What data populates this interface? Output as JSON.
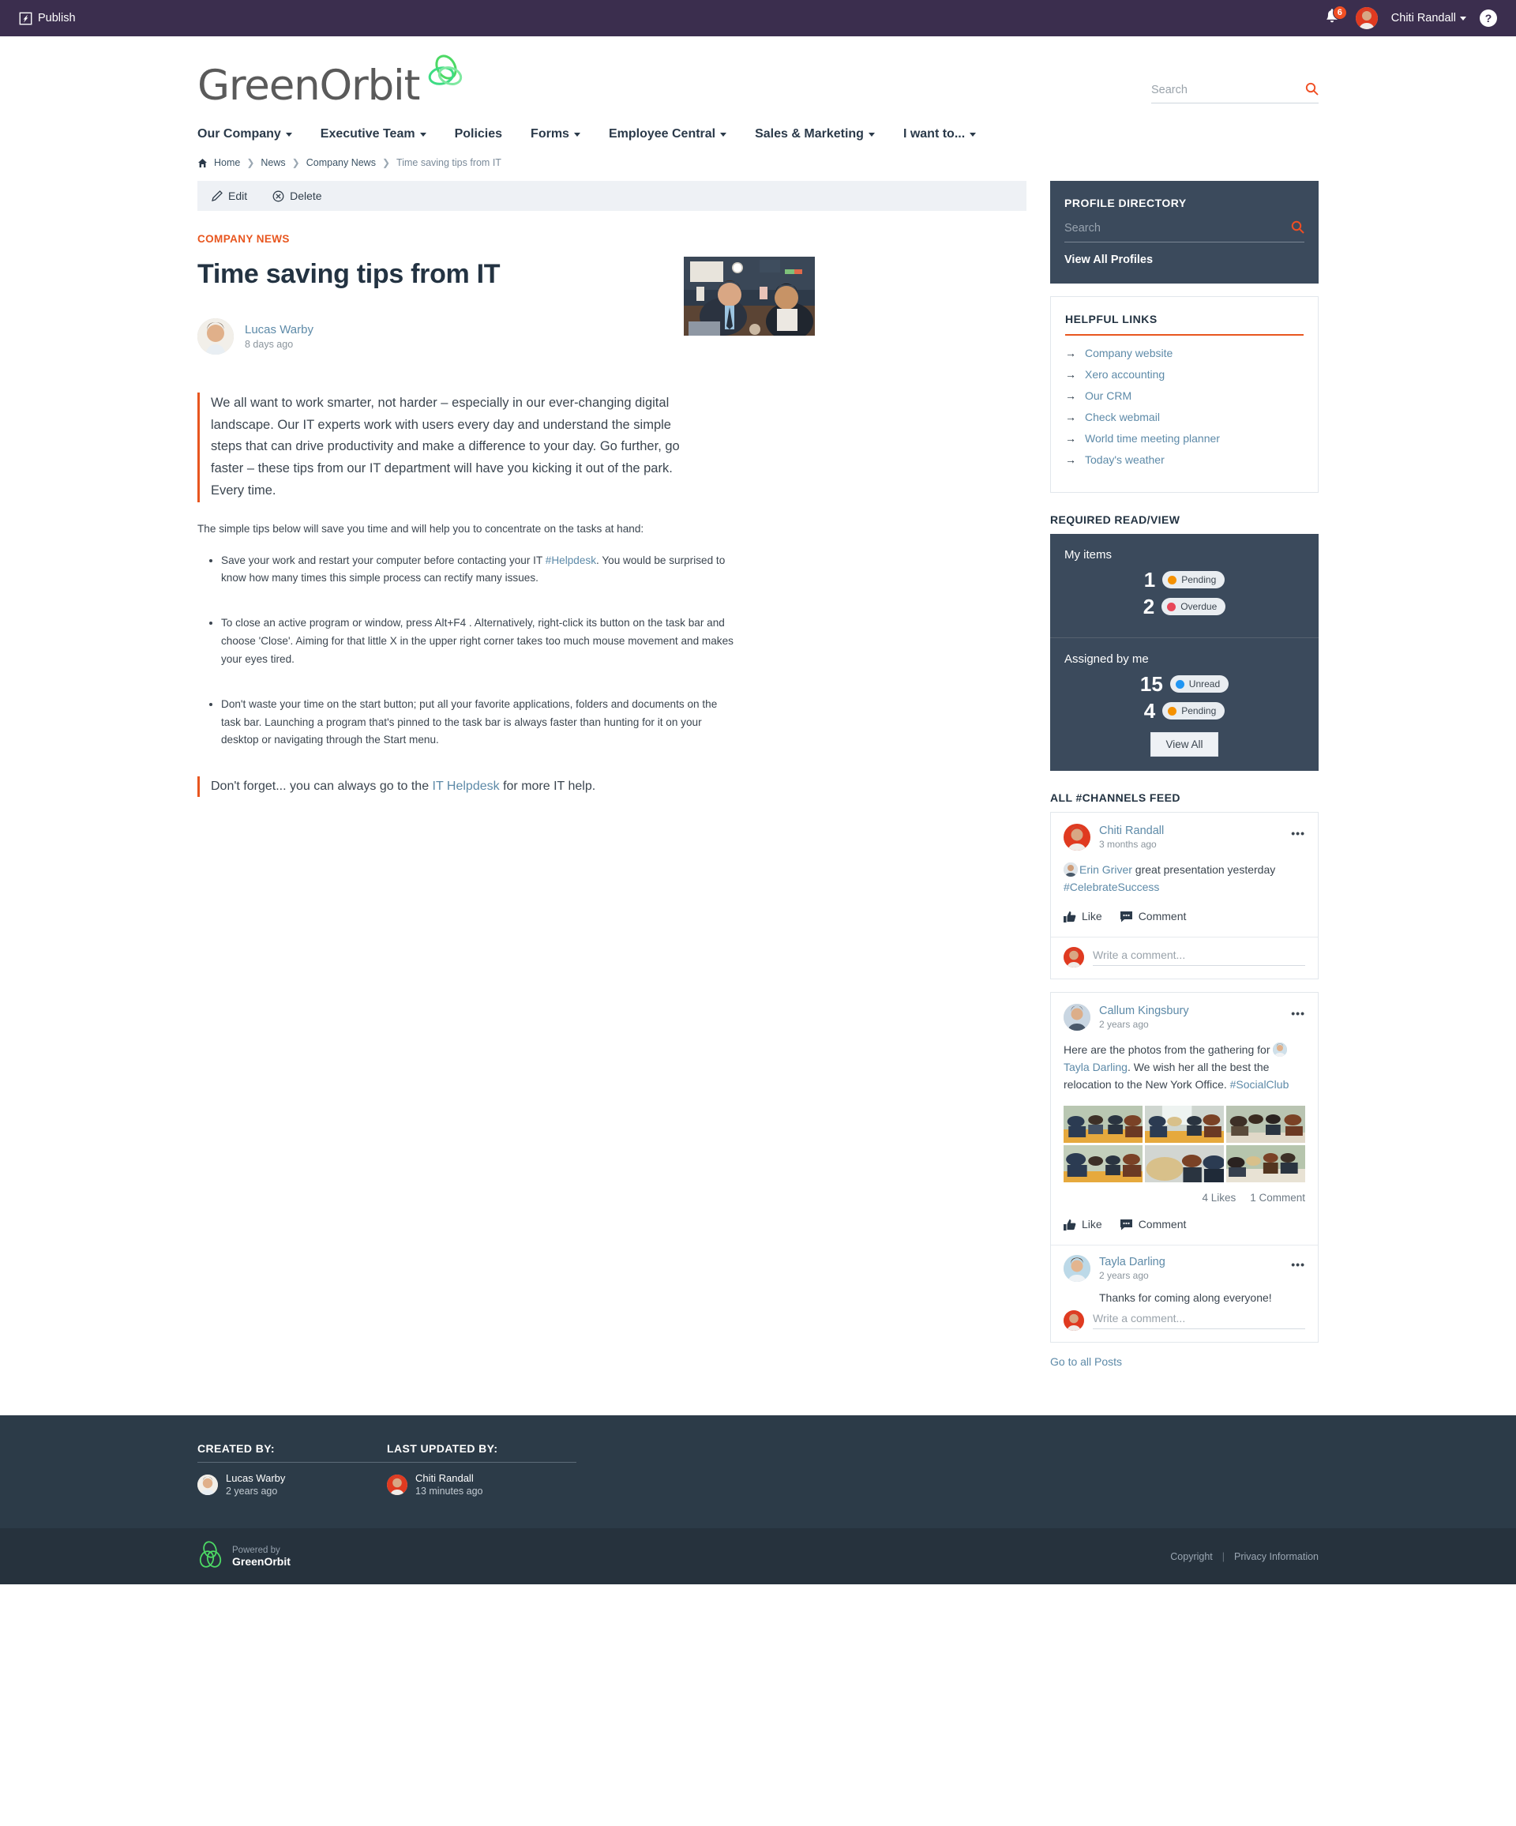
{
  "topbar": {
    "publish_label": "Publish",
    "publish_icon": "publish-icon",
    "bell_icon": "notification-bell-icon",
    "notification_count": "6",
    "user_name": "Chiti Randall",
    "help_label": "?"
  },
  "brand": {
    "logo_text": "GreenOrbit",
    "logo_mark_icon": "greenorbit-orbit-icon"
  },
  "search": {
    "placeholder": "Search",
    "value": "",
    "icon": "search-icon"
  },
  "nav": {
    "items": [
      {
        "label": "Our Company",
        "has_caret": true
      },
      {
        "label": "Executive Team",
        "has_caret": true
      },
      {
        "label": "Policies",
        "has_caret": false
      },
      {
        "label": "Forms",
        "has_caret": true
      },
      {
        "label": "Employee Central",
        "has_caret": true
      },
      {
        "label": "Sales & Marketing",
        "has_caret": true
      },
      {
        "label": "I want to...",
        "has_caret": true
      }
    ]
  },
  "breadcrumb": {
    "home_icon": "home-icon",
    "items": [
      "Home",
      "News",
      "Company News",
      "Time saving tips from IT"
    ]
  },
  "actionbar": {
    "edit_label": "Edit",
    "edit_icon": "pencil-icon",
    "delete_label": "Delete",
    "delete_icon": "delete-circle-icon"
  },
  "article": {
    "kicker": "COMPANY NEWS",
    "title": "Time saving tips from IT",
    "author": "Lucas Warby",
    "author_time": "8 days ago",
    "lead": "We all want to work smarter, not harder – especially in our ever-changing digital landscape. Our IT experts work with users every day and understand the simple steps that can drive productivity and make a difference to your day. Go further, go faster – these tips from our IT department will have you kicking it out of the park. Every time.",
    "intro": "The simple tips below will save you time and will help you to concentrate on the tasks at hand:",
    "tips": [
      {
        "part1": "Save your work and restart your computer before contacting your IT ",
        "link": "#Helpdesk",
        "part2": ". You would be surprised to know how many times this simple process can rectify many issues."
      },
      {
        "part1": "To close an active program or window, press Alt+F4 . Alternatively, right-click its button on the task bar and choose 'Close'. Aiming for that little X in the upper right corner takes too much mouse movement and makes your eyes tired.",
        "link": "",
        "part2": ""
      },
      {
        "part1": "Don't waste your time on the start button; put all your favorite applications, folders and documents on the task bar. Launching a program that's pinned to the task bar is always faster than hunting for it on your desktop or navigating through the Start menu.",
        "link": "",
        "part2": ""
      }
    ],
    "closing_pre": "Don't forget... you can always go to the ",
    "closing_link": "IT Helpdesk",
    "closing_post": " for more IT help."
  },
  "profile_directory": {
    "title": "PROFILE DIRECTORY",
    "search_placeholder": "Search",
    "search_value": "",
    "search_icon": "search-icon",
    "view_all_label": "View All Profiles"
  },
  "helpful_links": {
    "title": "HELPFUL LINKS",
    "items": [
      "Company website",
      "Xero accounting",
      "Our CRM",
      "Check webmail",
      "World time meeting planner",
      "Today's weather"
    ]
  },
  "required_read": {
    "section_label": "REQUIRED READ/VIEW",
    "my_items": {
      "heading": "My items",
      "rows": [
        {
          "count": "1",
          "status": "Pending",
          "color": "#f59100"
        },
        {
          "count": "2",
          "status": "Overdue",
          "color": "#e8485a"
        }
      ]
    },
    "assigned_by_me": {
      "heading": "Assigned by me",
      "rows": [
        {
          "count": "15",
          "status": "Unread",
          "color": "#2196f3"
        },
        {
          "count": "4",
          "status": "Pending",
          "color": "#f59100"
        }
      ]
    },
    "view_all_label": "View All"
  },
  "feed": {
    "section_label": "ALL #CHANNELS FEED",
    "like_label": "Like",
    "comment_label": "Comment",
    "like_icon": "thumbs-up-icon",
    "comment_icon": "comment-bubble-icon",
    "comment_placeholder": "Write a comment...",
    "kebab_icon": "more-options-icon",
    "posts": [
      {
        "author": "Chiti Randall",
        "time": "3 months ago",
        "mention": "Erin Griver",
        "text_after_mention": " great presentation yesterday ",
        "hashtag": "#CelebrateSuccess",
        "has_photos": false,
        "likes": "",
        "comments": ""
      },
      {
        "author": "Callum Kingsbury",
        "time": "2 years ago",
        "text_before_mention": "Here are the photos from the gathering for ",
        "mention": "Tayla Darling",
        "text_after_mention": ". We wish her all the best the relocation to the New York Office. ",
        "hashtag": "#SocialClub",
        "has_photos": true,
        "likes": "4 Likes",
        "comments": "1 Comment",
        "reply": {
          "author": "Tayla Darling",
          "time": "2 years ago",
          "text": "Thanks for coming along everyone!"
        }
      }
    ],
    "go_to_all_label": "Go to all Posts"
  },
  "footer_meta": {
    "created_by_title": "CREATED BY:",
    "created_by_name": "Lucas Warby",
    "created_by_time": "2 years ago",
    "last_updated_title": "LAST UPDATED BY:",
    "last_updated_name": "Chiti Randall",
    "last_updated_time": "13 minutes ago"
  },
  "footer": {
    "powered_by": "Powered by",
    "brand": "GreenOrbit",
    "copyright_label": "Copyright",
    "privacy_label": "Privacy Information"
  },
  "colors": {
    "topbar": "#3b2e4e",
    "accent_orange": "#e8561f",
    "panel_dark": "#3b4a5c",
    "footer_meta": "#2c3b48",
    "footer_bar": "#26323d",
    "link_blue": "#5d8aa8",
    "brand_green": "#4cd964"
  }
}
